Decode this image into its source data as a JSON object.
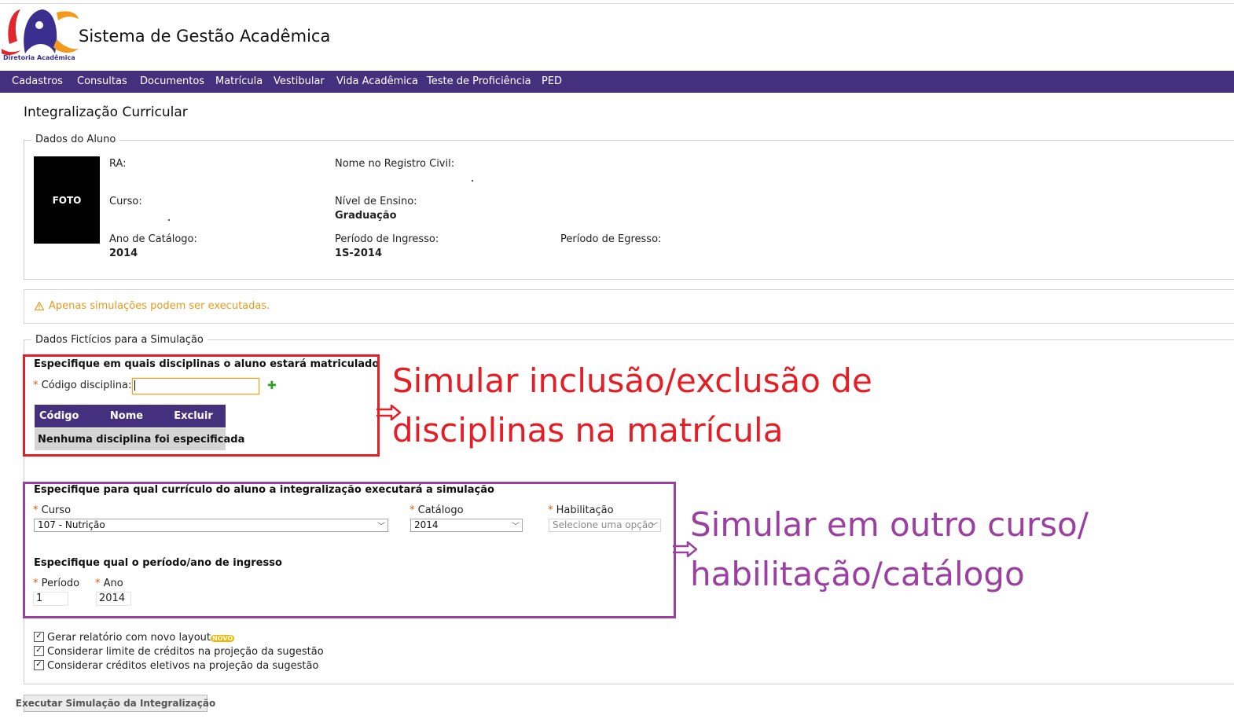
{
  "header": {
    "logo_text": "Diretoria Acadêmica",
    "app_title": "Sistema de Gestão Acadêmica"
  },
  "nav": {
    "items": [
      "Cadastros",
      "Consultas",
      "Documentos",
      "Matrícula",
      "Vestibular",
      "Vida Acadêmica",
      "Teste de Proficiência",
      "PED"
    ]
  },
  "page": {
    "title": "Integralização Curricular"
  },
  "student": {
    "legend": "Dados do Aluno",
    "photo_label": "FOTO",
    "ra_label": "RA:",
    "nome_label": "Nome no Registro Civil:",
    "curso_label": "Curso:",
    "nivel_label": "Nível de Ensino:",
    "nivel_value": "Graduação",
    "catalogo_label": "Ano de Catálogo:",
    "catalogo_value": "2014",
    "ingresso_label": "Período de Ingresso:",
    "ingresso_value": "1S-2014",
    "egresso_label": "Período de Egresso:"
  },
  "alert": {
    "text": "Apenas simulações podem ser executadas.",
    "color": "#e89a1a"
  },
  "simulation": {
    "legend": "Dados Fictícios para a Simulação",
    "disciplinas": {
      "heading": "Especifique em quais disciplinas o aluno estará matriculado",
      "codigo_label": "Código disciplina:",
      "codigo_value": "",
      "table_headers": [
        "Código",
        "Nome",
        "Excluir"
      ],
      "empty_message": "Nenhuma disciplina foi especificada"
    },
    "curriculo": {
      "heading": "Especifique para qual currículo do aluno a integralização executará a simulação",
      "curso_label": "Curso",
      "curso_value": "107 - Nutrição",
      "catalogo_label": "Catálogo",
      "catalogo_value": "2014",
      "habilitacao_label": "Habilitação",
      "habilitacao_placeholder": "Selecione uma opção"
    },
    "ingresso": {
      "heading": "Especifique qual o período/ano de ingresso",
      "periodo_label": "Período",
      "periodo_value": "1",
      "ano_label": "Ano",
      "ano_value": "2014"
    },
    "options": [
      {
        "label": "Gerar relatório com novo layout",
        "checked": true,
        "badge": "NOVO"
      },
      {
        "label": "Considerar limite de créditos na projeção da sugestão",
        "checked": true
      },
      {
        "label": "Considerar créditos eletivos na projeção da sugestão",
        "checked": true
      }
    ],
    "execute_button": "Executar Simulação da Integralização"
  },
  "annotations": {
    "red_line1": "Simular inclusão/exclusão de",
    "red_line2": "disciplinas na matrícula",
    "purple_line1": "Simular em outro curso/",
    "purple_line2": "habilitação/catálogo",
    "red_color": "#e51e25",
    "purple_color": "#9b3fa0"
  },
  "theme": {
    "nav_bg": "#45307e",
    "table_header_bg": "#45307e"
  }
}
